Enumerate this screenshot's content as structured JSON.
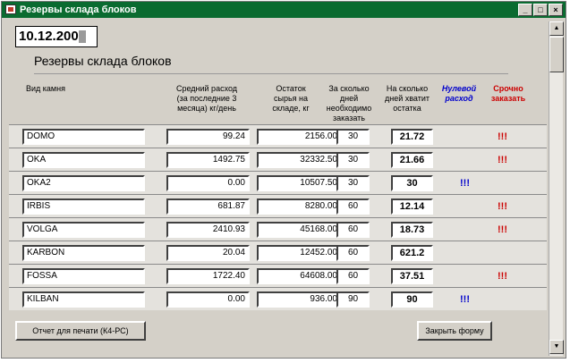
{
  "window": {
    "title": "Резервы склада блоков",
    "controls": [
      "_",
      "□",
      "×"
    ]
  },
  "form": {
    "date": "10.12.200",
    "title": "Резервы склада блоков",
    "headers": {
      "name": "Вид камня",
      "avg": "Средний расход (за последние 3 месяца) кг/день",
      "stock": "Остаток сырья на складе, кг",
      "days": "За сколько дней необходимо заказать",
      "enough": "На сколько дней хватит остатка",
      "zero": "Нулевой расход",
      "urgent": "Срочно заказать"
    },
    "rows": [
      {
        "name": "DOMO",
        "avg": "99.24",
        "stock": "2156.00",
        "days": "30",
        "enough": "21.72",
        "zero": "",
        "urgent": "!!!"
      },
      {
        "name": "OKA",
        "avg": "1492.75",
        "stock": "32332.50",
        "days": "30",
        "enough": "21.66",
        "zero": "",
        "urgent": "!!!"
      },
      {
        "name": "OKA2",
        "avg": "0.00",
        "stock": "10507.50",
        "days": "30",
        "enough": "30",
        "zero": "!!!",
        "urgent": ""
      },
      {
        "name": "IRBIS",
        "avg": "681.87",
        "stock": "8280.00",
        "days": "60",
        "enough": "12.14",
        "zero": "",
        "urgent": "!!!"
      },
      {
        "name": "VOLGA",
        "avg": "2410.93",
        "stock": "45168.00",
        "days": "60",
        "enough": "18.73",
        "zero": "",
        "urgent": "!!!"
      },
      {
        "name": "KARBON",
        "avg": "20.04",
        "stock": "12452.00",
        "days": "60",
        "enough": "621.2",
        "zero": "",
        "urgent": ""
      },
      {
        "name": "FOSSA",
        "avg": "1722.40",
        "stock": "64608.00",
        "days": "60",
        "enough": "37.51",
        "zero": "",
        "urgent": "!!!"
      },
      {
        "name": "KILBAN",
        "avg": "0.00",
        "stock": "936.00",
        "days": "90",
        "enough": "90",
        "zero": "!!!",
        "urgent": ""
      }
    ],
    "buttons": {
      "print": "Отчет для печати (К4-РС)",
      "close": "Закрыть форму"
    }
  },
  "colors": {
    "titlebar": "#0a6b30",
    "zero": "#0000cc",
    "urgent": "#cc0000",
    "face": "#d4d0c8"
  }
}
